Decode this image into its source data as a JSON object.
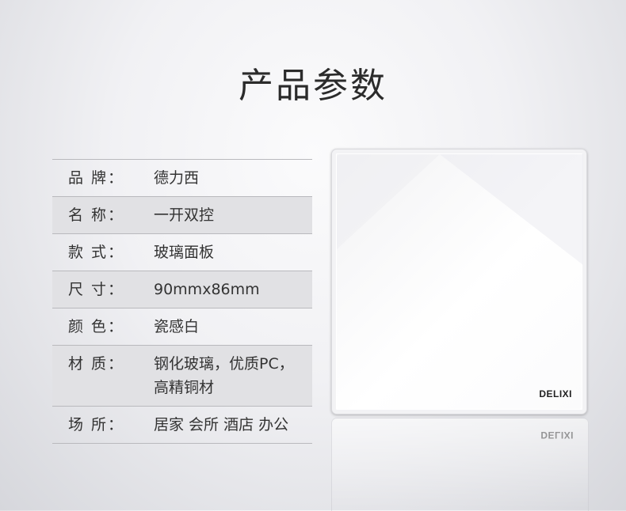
{
  "title": "产品参数",
  "specs": [
    {
      "key": "品  牌：",
      "value": "德力西"
    },
    {
      "key": "名  称：",
      "value": "一开双控"
    },
    {
      "key": "款  式：",
      "value": "玻璃面板"
    },
    {
      "key": "尺  寸：",
      "value": "90mmx86mm"
    },
    {
      "key": "颜  色：",
      "value": "瓷感白"
    },
    {
      "key": "材  质：",
      "value": "钢化玻璃，优质PC，\n高精铜材"
    },
    {
      "key": "场  所：",
      "value": "居家 会所 酒店 办公"
    }
  ],
  "product": {
    "logo": "DELIXI",
    "color": "#ffffff"
  }
}
